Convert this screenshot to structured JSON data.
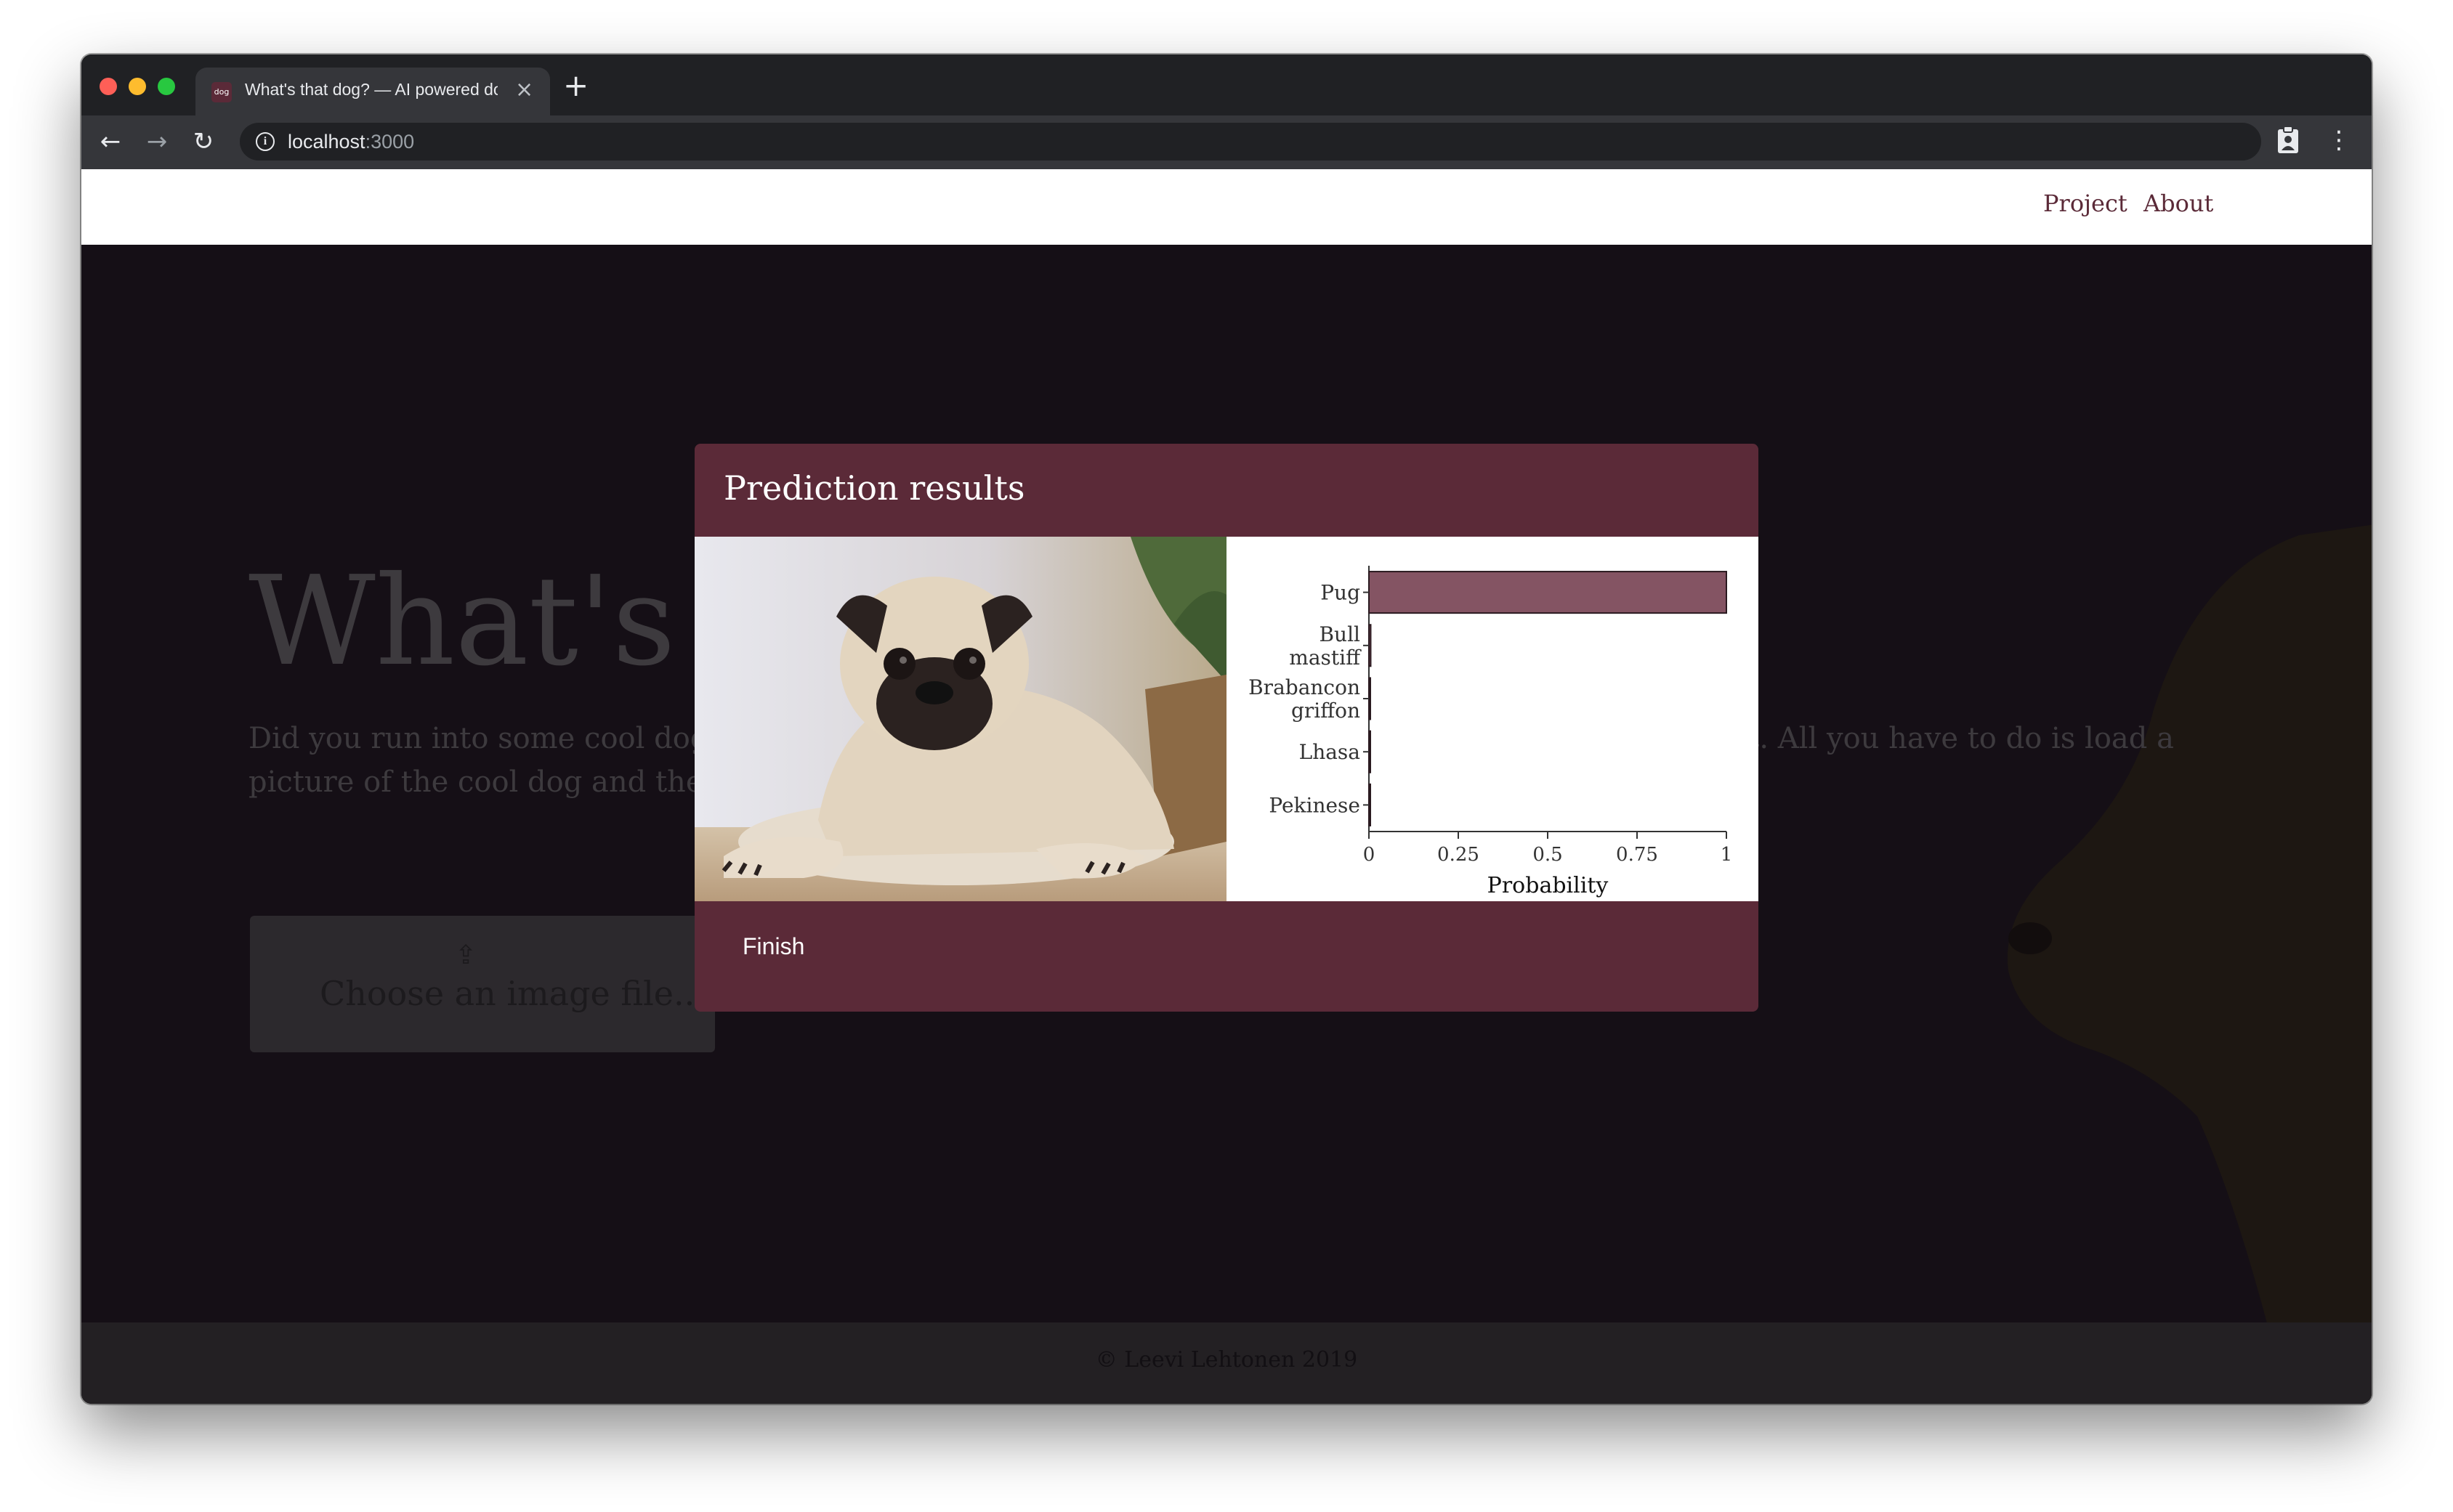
{
  "browser": {
    "tab_title": "What's that dog? — AI powered dog breed identification",
    "tab_favicon": "dog",
    "url_host": "localhost",
    "url_port": ":3000"
  },
  "nav": {
    "project": "Project",
    "about": "About"
  },
  "hero": {
    "title": "What's that dog?",
    "description": "Did you run into some cool dog and want to know what breed it is? We are here to help you to find out. All you have to do is load a picture of the cool dog and then the AI will tell you the breed.",
    "upload_label": "Choose an image file..."
  },
  "footer": {
    "text": "© Leevi Lehtonen 2019"
  },
  "modal": {
    "title": "Prediction results",
    "finish_label": "Finish"
  },
  "colors": {
    "accent": "#5b2a38",
    "bar": "#845463",
    "page_bg": "#150f16"
  },
  "chart_data": {
    "type": "bar",
    "orientation": "horizontal",
    "categories": [
      [
        "Pug"
      ],
      [
        "Bull",
        "mastiff"
      ],
      [
        "Brabancon",
        "griffon"
      ],
      [
        "Lhasa"
      ],
      [
        "Pekinese"
      ]
    ],
    "values": [
      1.0,
      0.005,
      0.001,
      0.0005,
      0.0003
    ],
    "xlabel": "Probability",
    "ylabel": "",
    "xlim": [
      0,
      1
    ],
    "ticks": [
      "0",
      "0.25",
      "0.5",
      "0.75",
      "1"
    ]
  }
}
